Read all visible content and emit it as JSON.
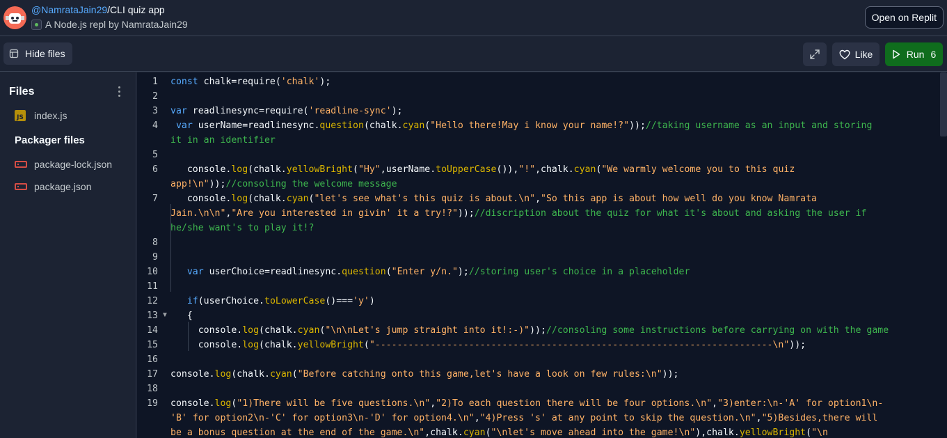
{
  "header": {
    "owner": "@NamrataJain29",
    "separator": "/",
    "repl_name": "CLI quiz app",
    "subtitle": "A Node.js repl by NamrataJain29",
    "open_button": "Open on Replit"
  },
  "toolbar": {
    "hide_files_label": "Hide files",
    "like_label": "Like",
    "run_label": "Run",
    "run_count": "6"
  },
  "sidebar": {
    "files_heading": "Files",
    "files": [
      {
        "name": "index.js",
        "icon": "js-file-icon"
      }
    ],
    "packager_heading": "Packager files",
    "packager_files": [
      {
        "name": "package-lock.json",
        "icon": "json-file-icon"
      },
      {
        "name": "package.json",
        "icon": "json-file-icon"
      }
    ]
  },
  "editor": {
    "line_numbers": [
      "1",
      "2",
      "3",
      "4",
      "5",
      "6",
      "7",
      "8",
      "9",
      "10",
      "11",
      "12",
      "13",
      "14",
      "15",
      "16",
      "17",
      "18",
      "19"
    ],
    "lines": [
      [
        [
          "kw",
          "const"
        ],
        [
          "pl",
          " chalk=require("
        ],
        [
          "str",
          "'chalk'"
        ],
        [
          "pl",
          ");"
        ]
      ],
      [],
      [
        [
          "kw",
          "var"
        ],
        [
          "pl",
          " readlinesync=require("
        ],
        [
          "str",
          "'readline-sync'"
        ],
        [
          "pl",
          ");"
        ]
      ],
      [
        [
          "pl",
          " "
        ],
        [
          "kw",
          "var"
        ],
        [
          "pl",
          " userName=readlinesync."
        ],
        [
          "fn",
          "question"
        ],
        [
          "pl",
          "(chalk."
        ],
        [
          "fn",
          "cyan"
        ],
        [
          "pl",
          "("
        ],
        [
          "str",
          "\"Hello there!May i know your name!?\""
        ],
        [
          "pl",
          "));"
        ],
        [
          "cm",
          "//taking username as an input and storing"
        ]
      ],
      [
        [
          "cm",
          "it in an identifier"
        ]
      ],
      [],
      [
        [
          "pl",
          "   console."
        ],
        [
          "fn",
          "log"
        ],
        [
          "pl",
          "(chalk."
        ],
        [
          "fn",
          "yellowBright"
        ],
        [
          "pl",
          "("
        ],
        [
          "str",
          "\"Hy\""
        ],
        [
          "pl",
          ",userName."
        ],
        [
          "fn",
          "toUpperCase"
        ],
        [
          "pl",
          "()),"
        ],
        [
          "str",
          "\"!\""
        ],
        [
          "pl",
          ",chalk."
        ],
        [
          "fn",
          "cyan"
        ],
        [
          "pl",
          "("
        ],
        [
          "str",
          "\"We warmly welcome you to this quiz"
        ]
      ],
      [
        [
          "str",
          "app!\\n\""
        ],
        [
          "pl",
          "));"
        ],
        [
          "cm",
          "//consoling the welcome message"
        ]
      ],
      [
        [
          "pl",
          "   console."
        ],
        [
          "fn",
          "log"
        ],
        [
          "pl",
          "(chalk."
        ],
        [
          "fn",
          "cyan"
        ],
        [
          "pl",
          "("
        ],
        [
          "str",
          "\"let's see what's this quiz is about.\\n\""
        ],
        [
          "pl",
          ","
        ],
        [
          "str",
          "\"So this app is about how well do you know Namrata"
        ]
      ],
      [
        [
          "str",
          "Jain.\\n\\n\""
        ],
        [
          "pl",
          ","
        ],
        [
          "str",
          "\"Are you interested in givin' it a try!?\""
        ],
        [
          "pl",
          "));"
        ],
        [
          "cm",
          "//discription about the quiz for what it's about and asking the user if"
        ]
      ],
      [
        [
          "cm",
          "he/she want's to play it!?"
        ]
      ],
      [],
      [],
      [
        [
          "pl",
          "   "
        ],
        [
          "kw",
          "var"
        ],
        [
          "pl",
          " userChoice=readlinesync."
        ],
        [
          "fn",
          "question"
        ],
        [
          "pl",
          "("
        ],
        [
          "str",
          "\"Enter y/n.\""
        ],
        [
          "pl",
          ");"
        ],
        [
          "cm",
          "//storing user's choice in a placeholder"
        ]
      ],
      [],
      [
        [
          "pl",
          "   "
        ],
        [
          "kw",
          "if"
        ],
        [
          "pl",
          "(userChoice."
        ],
        [
          "fn",
          "toLowerCase"
        ],
        [
          "pl",
          "()==="
        ],
        [
          "str",
          "'y'"
        ],
        [
          "pl",
          ")"
        ]
      ],
      [
        [
          "pl",
          "   {"
        ]
      ],
      [
        [
          "pl",
          "     console."
        ],
        [
          "fn",
          "log"
        ],
        [
          "pl",
          "(chalk."
        ],
        [
          "fn",
          "cyan"
        ],
        [
          "pl",
          "("
        ],
        [
          "str",
          "\"\\n\\nLet's jump straight into it!:-)\""
        ],
        [
          "pl",
          "));"
        ],
        [
          "cm",
          "//consoling some instructions before carrying on with the game"
        ]
      ],
      [
        [
          "pl",
          "     console."
        ],
        [
          "fn",
          "log"
        ],
        [
          "pl",
          "(chalk."
        ],
        [
          "fn",
          "yellowBright"
        ],
        [
          "pl",
          "("
        ],
        [
          "str",
          "\"------------------------------------------------------------------------\\n\""
        ],
        [
          "pl",
          "));"
        ]
      ],
      [],
      [
        [
          "pl",
          "console."
        ],
        [
          "fn",
          "log"
        ],
        [
          "pl",
          "(chalk."
        ],
        [
          "fn",
          "cyan"
        ],
        [
          "pl",
          "("
        ],
        [
          "str",
          "\"Before catching onto this game,let's have a look on few rules:\\n\""
        ],
        [
          "pl",
          "));"
        ]
      ],
      [],
      [
        [
          "pl",
          "console."
        ],
        [
          "fn",
          "log"
        ],
        [
          "pl",
          "("
        ],
        [
          "str",
          "\"1)There will be five questions.\\n\""
        ],
        [
          "pl",
          ","
        ],
        [
          "str",
          "\"2)To each question there will be four options.\\n\""
        ],
        [
          "pl",
          ","
        ],
        [
          "str",
          "\"3)enter:\\n-'A' for option1\\n-"
        ]
      ],
      [
        [
          "str",
          "'B' for option2\\n-'C' for option3\\n-'D' for option4.\\n\""
        ],
        [
          "pl",
          ","
        ],
        [
          "str",
          "\"4)Press 's' at any point to skip the question.\\n\""
        ],
        [
          "pl",
          ","
        ],
        [
          "str",
          "\"5)Besides,there will"
        ]
      ],
      [
        [
          "str",
          "be a bonus question at the end of the game.\\n\""
        ],
        [
          "pl",
          ",chalk."
        ],
        [
          "fn",
          "cyan"
        ],
        [
          "pl",
          "("
        ],
        [
          "str",
          "\"\\nlet's move ahead into the game!\\n\""
        ],
        [
          "pl",
          "),chalk."
        ],
        [
          "fn",
          "yellowBright"
        ],
        [
          "pl",
          "("
        ],
        [
          "str",
          "\"\\n"
        ]
      ]
    ]
  },
  "colors": {
    "keyword": "#57abff",
    "string": "#ffb266",
    "function": "#dbb600",
    "comment": "#3eb64e",
    "run_button": "#0f6d1d"
  }
}
